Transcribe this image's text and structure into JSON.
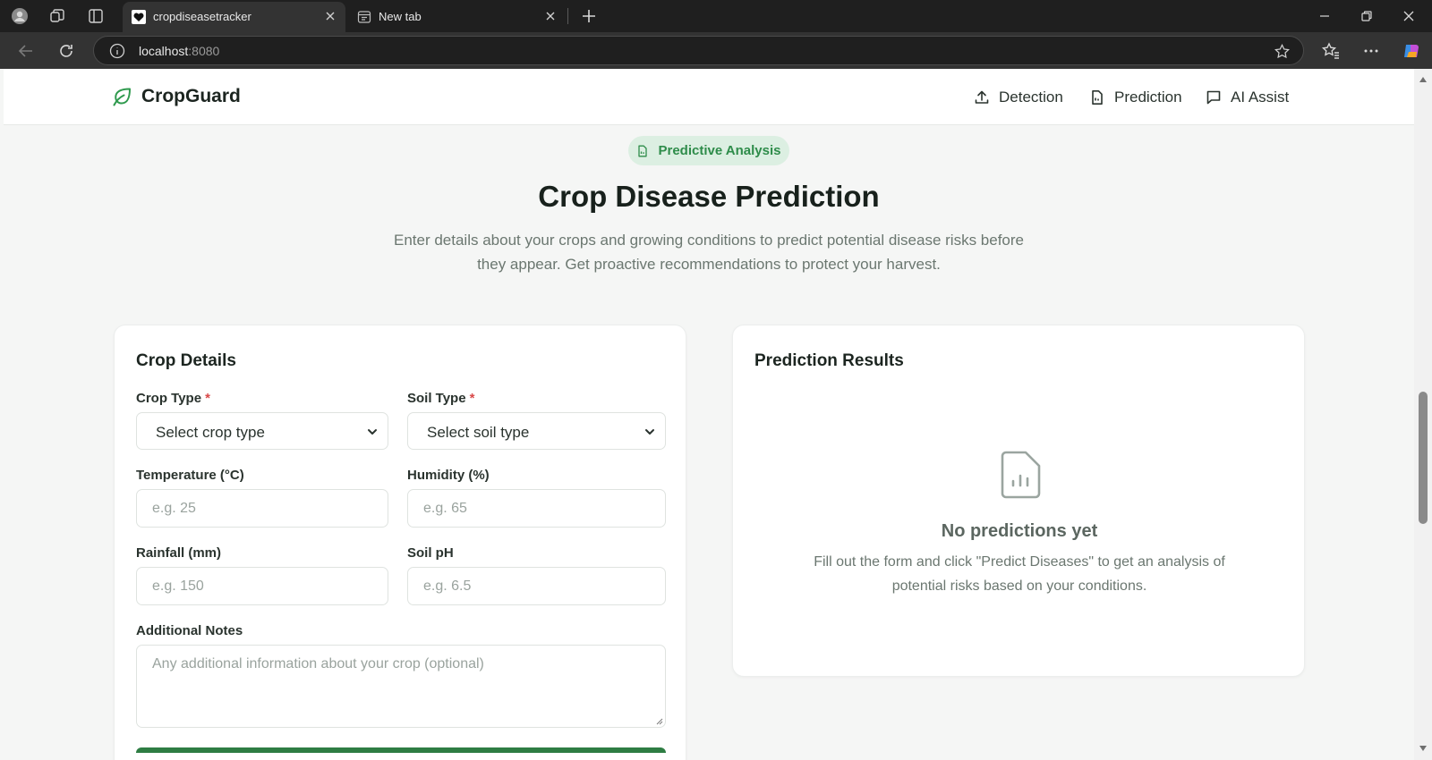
{
  "browser": {
    "tabs": [
      {
        "title": "cropdiseasetracker",
        "active": true
      },
      {
        "title": "New tab",
        "active": false
      }
    ],
    "address": {
      "host": "localhost",
      "port": ":8080"
    }
  },
  "header": {
    "brand": "CropGuard",
    "nav": [
      {
        "label": "Detection",
        "icon": "upload-icon"
      },
      {
        "label": "Prediction",
        "icon": "file-icon"
      },
      {
        "label": "AI Assist",
        "icon": "chat-icon"
      }
    ]
  },
  "hero": {
    "badge": "Predictive Analysis",
    "title": "Crop Disease Prediction",
    "description": "Enter details about your crops and growing conditions to predict potential disease risks before they appear. Get proactive recommendations to protect your harvest."
  },
  "form": {
    "title": "Crop Details",
    "required_mark": "*",
    "crop_type": {
      "label": "Crop Type",
      "value": "Select crop type"
    },
    "soil_type": {
      "label": "Soil Type",
      "value": "Select soil type"
    },
    "temperature": {
      "label": "Temperature (°C)",
      "placeholder": "e.g. 25"
    },
    "humidity": {
      "label": "Humidity (%)",
      "placeholder": "e.g. 65"
    },
    "rainfall": {
      "label": "Rainfall (mm)",
      "placeholder": "e.g. 150"
    },
    "soil_ph": {
      "label": "Soil pH",
      "placeholder": "e.g. 6.5"
    },
    "notes": {
      "label": "Additional Notes",
      "placeholder": "Any additional information about your crop (optional)"
    }
  },
  "results": {
    "title": "Prediction Results",
    "empty_title": "No predictions yet",
    "empty_description": "Fill out the form and click \"Predict Diseases\" to get an analysis of potential risks based on your conditions."
  },
  "colors": {
    "brand_green": "#2f9a4e",
    "badge_bg": "#dcefe2",
    "required_red": "#d94848",
    "button_green": "#2e7d43"
  }
}
